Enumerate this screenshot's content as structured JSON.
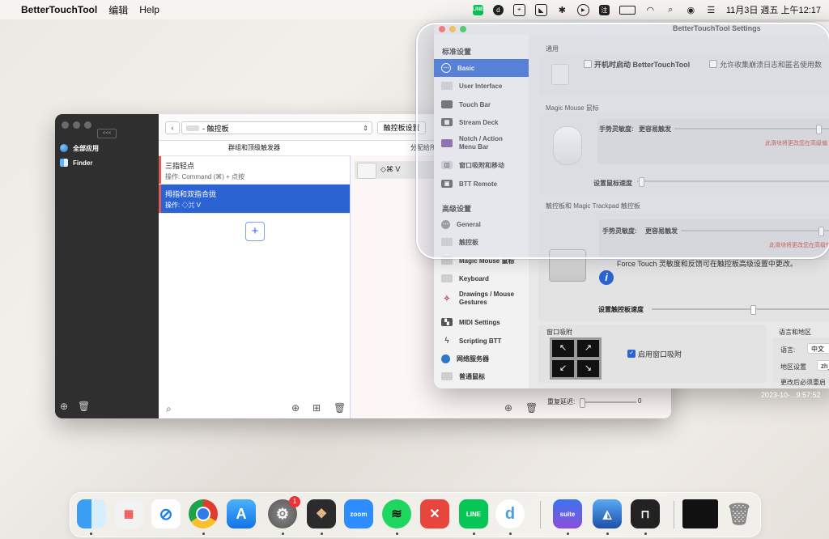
{
  "menubar": {
    "app_name": "BetterTouchTool",
    "menus": [
      "编辑",
      "Help"
    ],
    "status": {
      "flag": "注",
      "battery": "",
      "datetime": "11月3日 週五 上午12:17"
    }
  },
  "main_window": {
    "sidebar": {
      "collapse": "<<<",
      "items": [
        "全部应用",
        "Finder"
      ]
    },
    "toolbar": {
      "device": "- 触控板",
      "settings_button": "触控板设置"
    },
    "trigger_column_header": "群组和顶级触发器",
    "action_column_header": "分配给所",
    "triggers": [
      {
        "title": "三指轻点",
        "detail": "操作: Command (⌘) + 点按"
      },
      {
        "title": "拇指和双指合拢",
        "detail": "操作: ◇⌘ V"
      }
    ],
    "action": "◇⌘ V"
  },
  "settings_window": {
    "title": "BetterTouchTool Settings",
    "sidebar": {
      "standard_section": "标准设置",
      "standard_items": [
        "Basic",
        "User Interface",
        "Touch Bar",
        "Stream Deck",
        "Notch / Action Menu Bar",
        "窗口吸附和移动",
        "BTT Remote"
      ],
      "advanced_section": "高级设置",
      "advanced_items": [
        "General",
        "触控板",
        "Magic Mouse 鼠标",
        "Keyboard",
        "Drawings / Mouse Gestures",
        "MIDI Settings",
        "Scripting BTT",
        "网络服务器",
        "普通鼠标"
      ]
    },
    "general": {
      "label": "通用",
      "launch_at_login": "开机时启动 BetterTouchTool",
      "crash_logs": "允许收集崩溃日志和匿名使用数"
    },
    "magic_mouse": {
      "label": "Magic Mouse 鼠标",
      "sensitivity": "手势灵敏度:",
      "more_sensitive": "更容易触发",
      "warning": "此滑块将更改您在高级偏",
      "speed": "设置鼠标速度"
    },
    "trackpad": {
      "label": "触控板和 Magic Trackpad 触控板",
      "sensitivity": "手势灵敏度:",
      "more_sensitive": "更容易触发",
      "warning": "此滑块将更改您在高级偏",
      "force_touch": "Force Touch 灵敏度和反馈可在触控板高级设置中更改。",
      "speed": "设置触控板速度"
    },
    "window_snap": {
      "label": "窗口吸附",
      "enable": "启用窗口吸附"
    },
    "language": {
      "label": "语言和地区",
      "language": "语言:",
      "language_value": "中文",
      "region": "地区设置",
      "region_value": "zh_",
      "restart": "更改后必须重启"
    }
  },
  "behind_window": {
    "repeat_delay": "重复延迟:",
    "repeat_value": "0"
  },
  "watermark": "2023-10-...9:57:52",
  "dock": {
    "apps": [
      "Finder",
      "Launchpad",
      "Safari",
      "Chrome",
      "App Store",
      "System Settings",
      "BetterTouchTool",
      "zoom",
      "Spotify",
      "XMind",
      "LINE",
      "Dict",
      "Suite",
      "Mosaic",
      "BTT",
      "Monitor",
      "Trash"
    ],
    "badge": "1"
  }
}
